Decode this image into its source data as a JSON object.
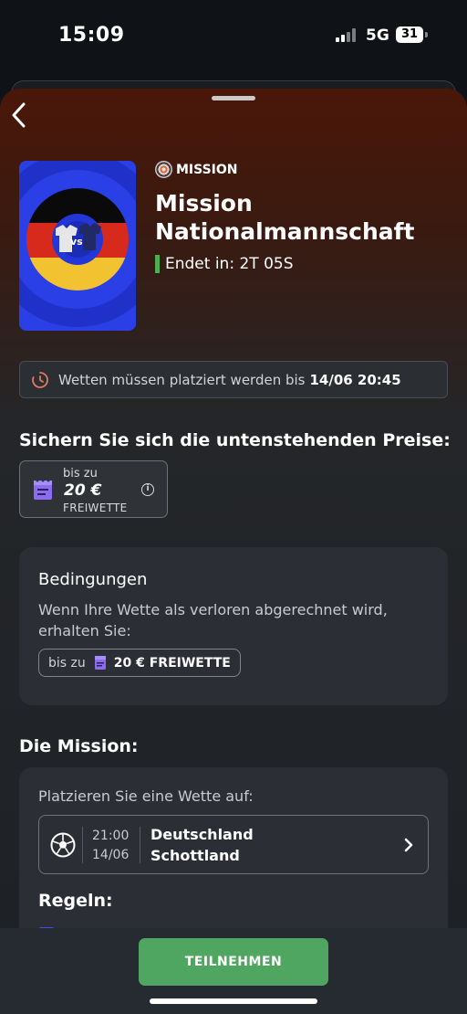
{
  "status_bar": {
    "time": "15:09",
    "network": "5G",
    "battery": "31"
  },
  "header": {
    "back_icon": "chevron-left-icon"
  },
  "mission": {
    "tag_label": "MISSION",
    "tag_icon": "target-icon",
    "title": "Mission Nationalmannschaft",
    "ends_label": "Endet in: 2T 05S",
    "ends_color": "#4caf50",
    "image_vs_text": "vs"
  },
  "deadline": {
    "text": "Wetten müssen platziert werden bis",
    "date": "14/06 20:45",
    "icon": "clock-icon"
  },
  "prizes": {
    "heading": "Sichern Sie sich die untenstehenden Preise:",
    "upto": "bis zu",
    "amount": "20 €",
    "label": "FREIWETTE",
    "icon": "free-bet-ticket-icon",
    "info_icon": "info-icon"
  },
  "conditions": {
    "title": "Bedingungen",
    "text": "Wenn Ihre Wette als verloren abgerechnet wird, erhalten Sie:",
    "upto": "bis zu",
    "reward": "20 € FREIWETTE"
  },
  "the_mission": {
    "heading": "Die Mission:",
    "place_label": "Platzieren Sie eine Wette auf:",
    "match": {
      "time": "21:00",
      "date": "14/06",
      "team_a": "Deutschland",
      "team_b": "Schottland",
      "sport_icon": "soccer-ball-icon"
    },
    "rules_heading": "Regeln:"
  },
  "footer": {
    "cta_label": "TEILNEHMEN",
    "cta_color": "#4fa660"
  }
}
